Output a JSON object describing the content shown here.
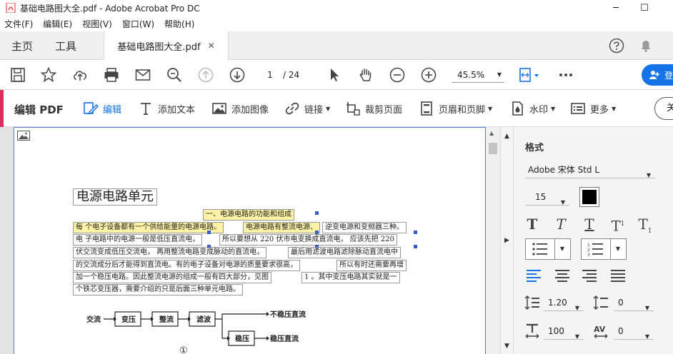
{
  "window": {
    "title": "基础电路图大全.pdf - Adobe Acrobat Pro DC",
    "controls": [
      "─",
      "☐"
    ]
  },
  "menu": [
    "文件(F)",
    "编辑(E)",
    "视图(V)",
    "窗口(W)",
    "帮助(H)"
  ],
  "tabs": {
    "home": "主页",
    "tools": "工具",
    "document": "基础电路图大全.pdf",
    "close_glyph": "✕"
  },
  "toolbar": {
    "current_page": "1",
    "page_count": "/ 24",
    "zoom": "45.5%",
    "signin_label": "登"
  },
  "editbar": {
    "label": "编辑 PDF",
    "tools": {
      "edit": "编辑",
      "add_text": "添加文本",
      "add_image": "添加图像",
      "link": "链接",
      "crop": "裁剪页面",
      "header_footer": "页眉和页脚",
      "watermark": "水印",
      "more": "更多"
    },
    "close_label": "关"
  },
  "document": {
    "heading": "电源电路单元",
    "section_title": "一、电源电路的功能和组成",
    "lines": {
      "l1a": "每  个电子设备都有一个供给能量的电源电路。",
      "l1b": "电源电路有整流电源、",
      "l1c": "逆变电源和变频器三种。",
      "l2a": "电  子电路中的电源一般是低压直流电，",
      "l2b": "所以要想从   220   伏市电变换成直流电，    应该先把  220",
      "l3a": "伏交流变成低压交流电，      再用整流电路变成脉动的直流电，",
      "l3b": "最后用滤波电路滤除脉动直流电中",
      "l4a": "的交流成分后才能得到直流电。有的电子设备对电源的质量要求很高，",
      "l4b": "所以有时还需要再增",
      "l5a": "加一个稳压电路。因此整流电源的组成一般有四大部分，见图",
      "l5b": "1  。其中变压电路其实就是一",
      "l6a": "个铁芯变压器，需要介绍的只是后面三种单元电路。"
    },
    "diagram": {
      "input": "交流",
      "block1": "变压",
      "block2": "整流",
      "block3": "滤波",
      "block4": "稳压",
      "out1": "不稳压直流",
      "out2": "稳压直流",
      "figure_no": "①"
    }
  },
  "format_panel": {
    "title": "格式",
    "font": "Adobe 宋体 Std L",
    "size": "15",
    "text_color": "#000000",
    "line_spacing": "1.20",
    "para_spacing": "0",
    "h_scale": "100",
    "char_spacing": "0"
  },
  "colors": {
    "accent": "#d6325e",
    "brand_blue": "#1473e6",
    "highlight": "#fdf2a6"
  }
}
